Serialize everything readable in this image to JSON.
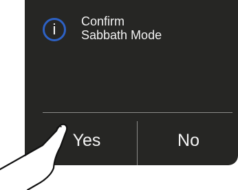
{
  "dialog": {
    "icon": "info-icon",
    "icon_glyph": "i",
    "message_line1": "Confirm",
    "message_line2": "Sabbath Mode",
    "yes_label": "Yes",
    "no_label": "No"
  },
  "colors": {
    "panel_background": "#262624",
    "icon_ring": "#2d61c4",
    "text": "#f2f2f2",
    "divider": "#8b8b89"
  }
}
